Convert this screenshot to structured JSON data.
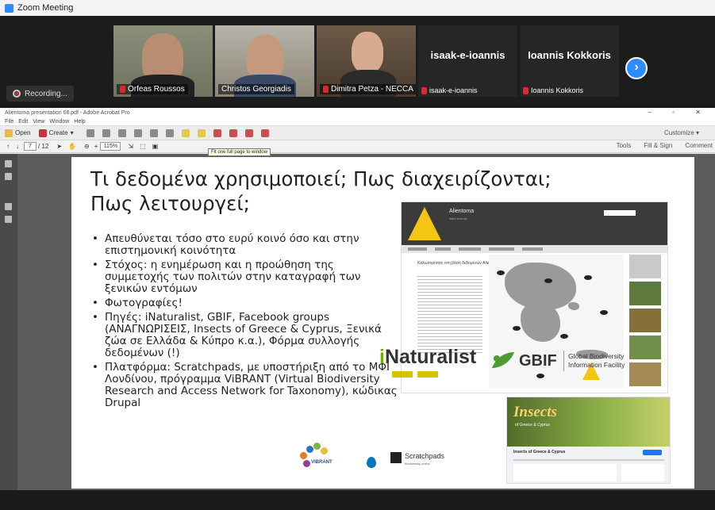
{
  "zoom": {
    "window_title": "Zoom Meeting",
    "recording_label": "Recording...",
    "participants": [
      {
        "name": "Orfeas Roussos",
        "muted": true
      },
      {
        "name": "Christos Georgiadis",
        "muted": false
      },
      {
        "name": "Dimitra Petza - NECCA ...",
        "muted": true
      },
      {
        "name": "isaak-e-ioannis",
        "muted": true,
        "video": false,
        "display": "isaak-e-ioannis"
      },
      {
        "name": "Ioannis Kokkoris",
        "muted": true,
        "video": false,
        "display": "Ioannis Kokkoris"
      }
    ],
    "next_icon": "chevron-right-icon"
  },
  "acrobat": {
    "window_title": "Alientoma presentation 68.pdf - Adobe Acrobat Pro",
    "menu": [
      "File",
      "Edit",
      "View",
      "Window",
      "Help"
    ],
    "open_label": "Open",
    "create_label": "Create",
    "customize_label": "Customize",
    "page_current": "7",
    "page_total": "/ 12",
    "zoom_level": "115%",
    "tooltip": "Fit one full page to window",
    "right_tabs": [
      "Tools",
      "Fill & Sign",
      "Comment"
    ]
  },
  "slide": {
    "title_line1": "Τι δεδομένα χρησιμοποιεί; Πως διαχειρίζονται;",
    "title_line2": "Πως λειτουργεί;",
    "bullets": [
      "Απευθύνεται τόσο στο ευρύ κοινό όσο και στην επιστημονική κοινότητα",
      "Στόχος: η ενημέρωση και η προώθηση της συμμετοχής των πολιτών στην καταγραφή των ξενικών εντόμων",
      "Φωτογραφίες!",
      "Πηγές: iNaturalist, GBIF, Facebook groups (ΑΝΑΓΝΩΡΙΣΕΙΣ, Insects of Greece & Cyprus, Ξενικά ζώα σε Ελλάδα & Κύπρο κ.α.), Φόρμα συλλογής δεδομένων (!)",
      "Πλατφόρμα: Scratchpads, με υποστήριξη από το ΜΦΙ Λονδίνου, πρόγραμμα ViBRANT (Virtual Biodiversity Research and Access Network for Taxonomy), κώδικας Drupal"
    ],
    "site": {
      "name": "Alientoma",
      "subtitle": "Alien Insects",
      "heading": "Καλωσορίσατε στη βάση δεδομένων Alientoma"
    },
    "inat_i": "i",
    "inat_rest": "Naturalist",
    "gbif_label": "GBIF",
    "gbif_tag_line1": "Global Biodiversity",
    "gbif_tag_line2": "Information Facility",
    "fb_insects": "Insects",
    "fb_greece": "of Greece & Cyprus",
    "fb_title": "Insects of Greece & Cyprus",
    "vibrant_label": "VIBRANT",
    "scratchpads_label": "Scratchpads",
    "scratchpads_sub": "biodiversity online"
  },
  "colors": {
    "zoom_blue": "#2d8cff",
    "muted_red": "#e02828",
    "inat_green": "#74ac00",
    "gbif_green": "#4c9c2e"
  }
}
